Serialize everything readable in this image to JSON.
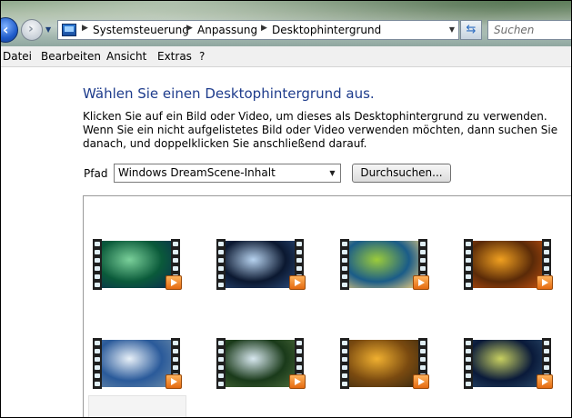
{
  "navbar": {
    "breadcrumb": [
      "Systemsteuerung",
      "Anpassung",
      "Desktophintergrund"
    ],
    "search_placeholder": "Suchen"
  },
  "menu": [
    "Datei",
    "Bearbeiten",
    "Ansicht",
    "Extras",
    "?"
  ],
  "content": {
    "title": "Wählen Sie einen Desktophintergrund aus.",
    "description": "Klicken Sie auf ein Bild oder Video, um dieses als Desktophintergrund zu verwenden. Wenn Sie ein nicht aufgelistetes Bild oder Video verwenden möchten, dann suchen Sie danach, und doppelklicken Sie anschließend darauf.",
    "path_label": "Pfad",
    "path_value": "Windows DreamScene-Inhalt",
    "browse_label": "Durchsuchen..."
  },
  "thumbnails": [
    {
      "icon": "aurora-video-thumbnail",
      "colors": [
        "#0a5a3a",
        "#7ad09a",
        "#0b2c50"
      ]
    },
    {
      "icon": "light-rays-video-thumbnail",
      "colors": [
        "#0b1830",
        "#b7d3f0",
        "#2a4a7a"
      ]
    },
    {
      "icon": "leaf-video-thumbnail",
      "colors": [
        "#1a5c88",
        "#9ccc3a",
        "#f0d080"
      ]
    },
    {
      "icon": "autumn-tree-video-thumbnail",
      "colors": [
        "#5a2a08",
        "#f0a020",
        "#c05010"
      ]
    },
    {
      "icon": "mountain-video-thumbnail",
      "colors": [
        "#2a5a9a",
        "#e8f0f8",
        "#6a8aa8"
      ]
    },
    {
      "icon": "waterfall-video-thumbnail",
      "colors": [
        "#1a3a1a",
        "#d8e8f0",
        "#4a6a3a"
      ]
    },
    {
      "icon": "flowers-video-thumbnail",
      "colors": [
        "#7a4a10",
        "#f0b030",
        "#3a2a10"
      ]
    },
    {
      "icon": "bubbles-video-thumbnail",
      "colors": [
        "#0a1a3a",
        "#c8d060",
        "#2a4a6a"
      ]
    }
  ]
}
